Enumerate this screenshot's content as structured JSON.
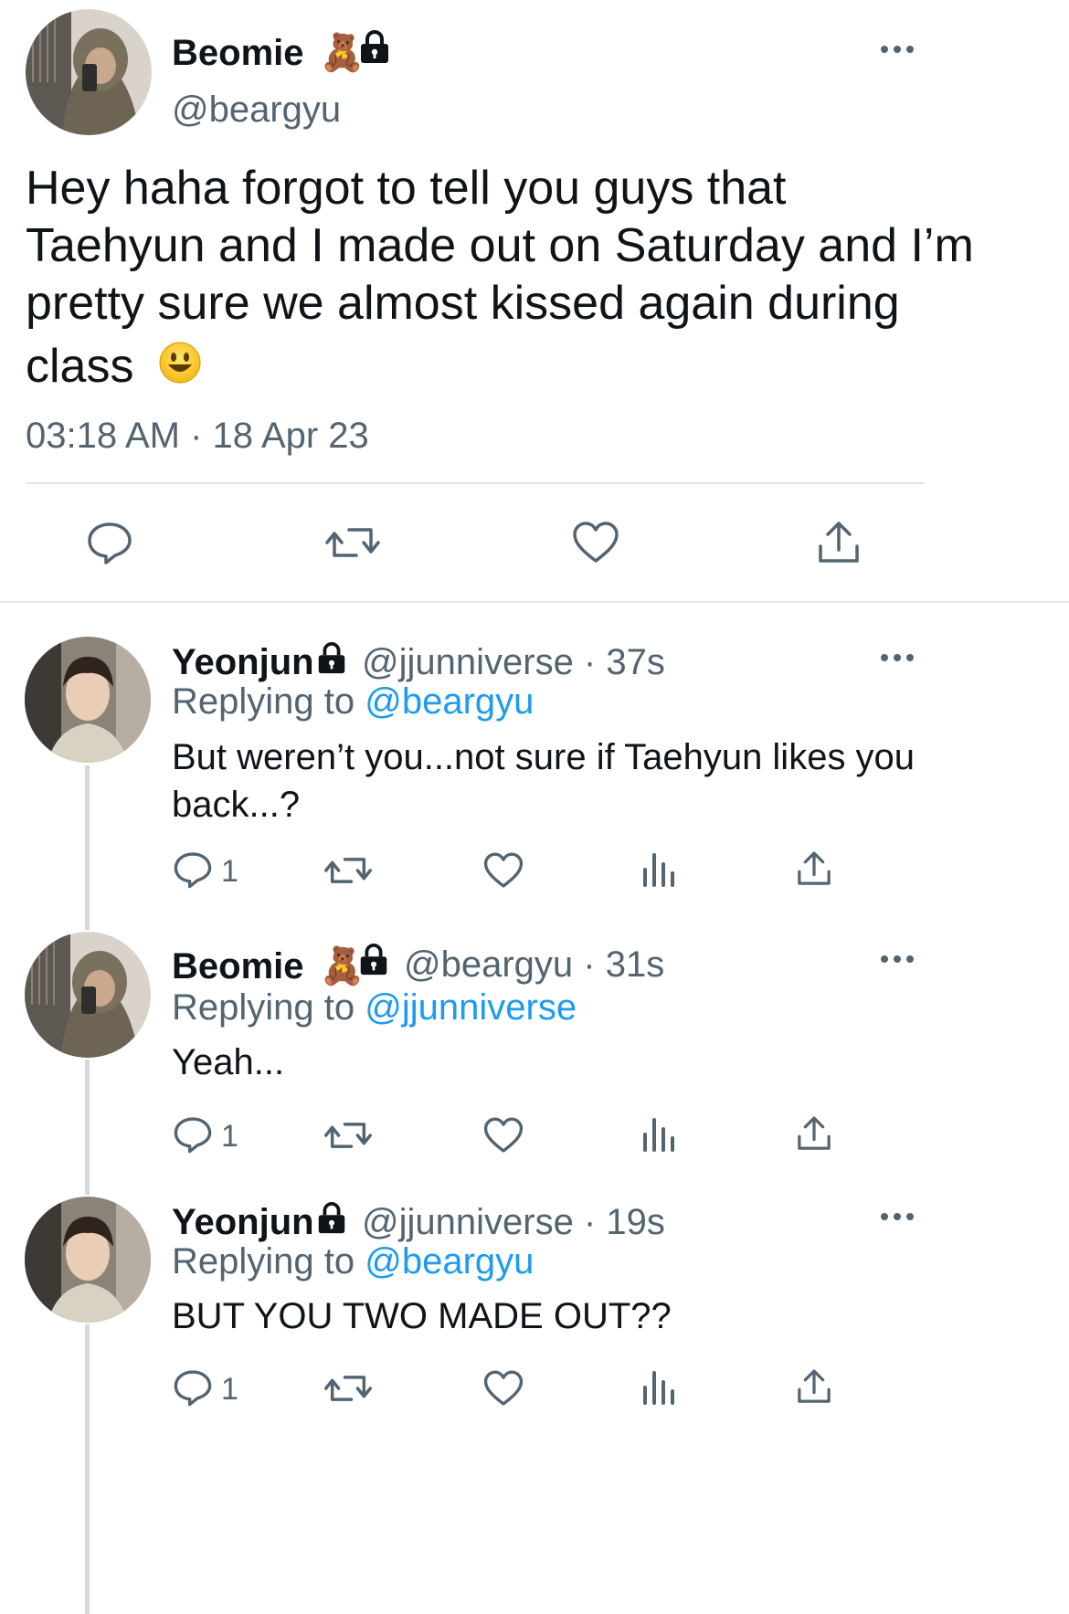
{
  "tweet": {
    "author_name": "Beomie",
    "author_emoji": "🧸",
    "handle": "@beargyu",
    "text": "Hey haha forgot to tell you guys that Taehyun and I made out on Saturday and I’m pretty sure we almost kissed again during class",
    "text_lines": [
      "Hey haha forgot to tell you guys that",
      "Taehyun and I made out on Saturday and I’m",
      "pretty sure we almost kissed again during",
      "class"
    ],
    "emoji": "😃",
    "timestamp": "03:18 AM · 18 Apr 23",
    "more_label": "•••"
  },
  "replies": [
    {
      "author_name": "Yeonjun",
      "handle_time": "@jjunniverse · 37s",
      "replying_prefix": "Replying to",
      "replying_to": "@beargyu",
      "text_lines": [
        "But weren’t you...not sure if Taehyun likes you",
        "back...?"
      ],
      "reply_count": "1"
    },
    {
      "author_name": "Beomie",
      "author_emoji": "🧸",
      "handle_time": "@beargyu · 31s",
      "replying_prefix": "Replying to",
      "replying_to": "@jjunniverse",
      "text_lines": [
        "Yeah..."
      ],
      "reply_count": "1"
    },
    {
      "author_name": "Yeonjun",
      "handle_time": "@jjunniverse · 19s",
      "replying_prefix": "Replying to",
      "replying_to": "@beargyu",
      "text_lines": [
        "BUT YOU TWO MADE OUT??"
      ],
      "reply_count": "1"
    }
  ],
  "colors": {
    "text": "#0f1419",
    "secondary": "#536471",
    "link": "#1d9bf0",
    "divider": "#e1e5e8"
  },
  "icons": {
    "reply": "reply-icon",
    "retweet": "retweet-icon",
    "like": "like-icon",
    "views": "views-icon",
    "share": "share-icon",
    "lock": "lock-icon",
    "more": "more-icon"
  }
}
